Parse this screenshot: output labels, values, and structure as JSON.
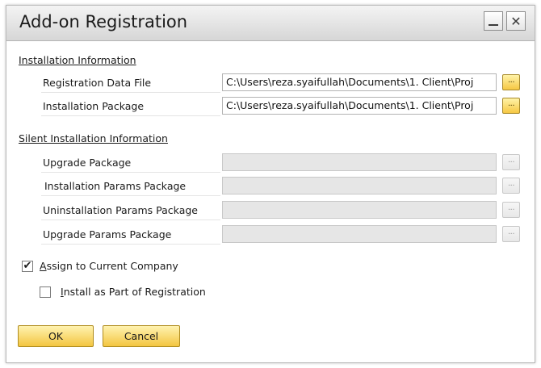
{
  "window": {
    "title": "Add-on Registration",
    "minimize_label": "",
    "close_label": "✕"
  },
  "installation": {
    "heading": "Installation Information",
    "registration_label": "Registration Data File",
    "registration_value": "C:\\Users\\reza.syaifullah\\Documents\\1. Client\\Proj",
    "package_label": "Installation Package",
    "package_value": "C:\\Users\\reza.syaifullah\\Documents\\1. Client\\Proj"
  },
  "silent": {
    "heading": "Silent Installation Information",
    "upgrade_label": "Upgrade Package",
    "install_params_label": "Installation Params Package",
    "uninstall_params_label": "Uninstallation Params Package",
    "upgrade_params_label": "Upgrade Params Package"
  },
  "browse_label": "...",
  "options": {
    "assign_first": "A",
    "assign_rest": "ssign to Current Company",
    "assign_checked": true,
    "install_first": "I",
    "install_rest": "nstall as Part of Registration",
    "install_checked": false
  },
  "buttons": {
    "ok": "OK",
    "cancel": "Cancel"
  },
  "colors": {
    "accent": "#f3c541",
    "accent_border": "#b08c1e"
  }
}
